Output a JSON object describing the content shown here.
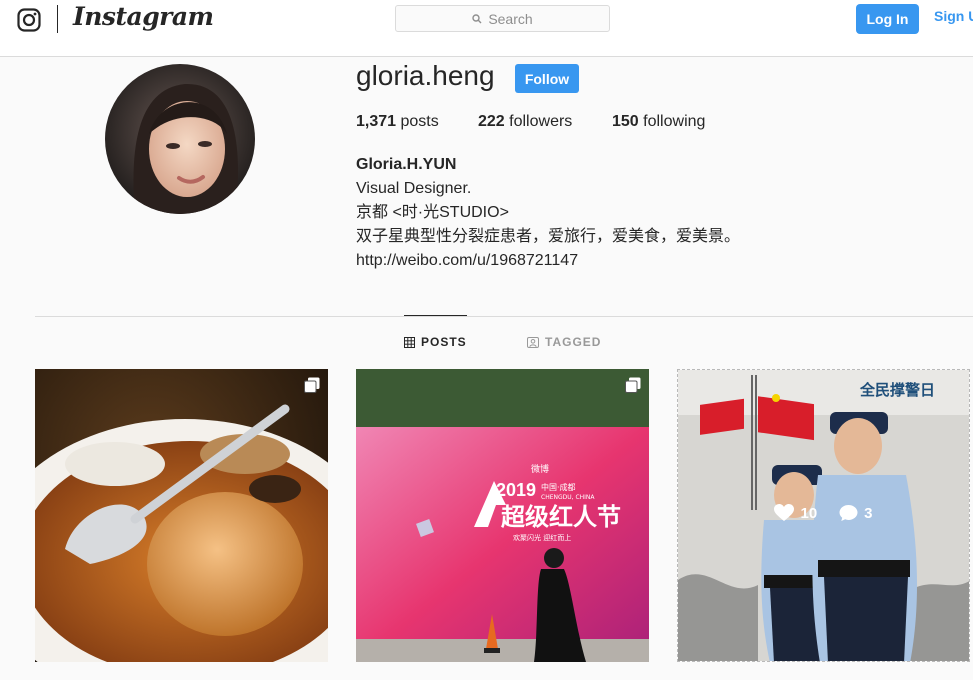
{
  "nav": {
    "brand": "Instagram",
    "search_placeholder": "Search",
    "login_label": "Log In",
    "signup_label": "Sign Up"
  },
  "profile": {
    "username": "gloria.heng",
    "follow_label": "Follow",
    "stats": [
      {
        "count": "1,371",
        "label": "posts"
      },
      {
        "count": "222",
        "label": "followers"
      },
      {
        "count": "150",
        "label": "following"
      }
    ],
    "full_name": "Gloria.H.YUN",
    "bio_lines": [
      "Visual Designer.",
      "京都 <时·光STUDIO>",
      "双子星典型性分裂症患者，爱旅行，爱美食，爱美景。"
    ],
    "link": "http://weibo.com/u/1968721147"
  },
  "tabs": {
    "posts_label": "POSTS",
    "tagged_label": "TAGGED"
  },
  "posts": [
    {
      "type": "multi",
      "description_icon": "carousel-icon"
    },
    {
      "type": "multi",
      "description_icon": "carousel-icon",
      "poster_text": {
        "event_year": "2019",
        "city": "中国·成都",
        "city_en": "CHENGDU, CHINA",
        "event_name": "超级红人节",
        "tagline": "欢聚闪光 迎红而上",
        "sponsor": "微博"
      }
    },
    {
      "type": "single",
      "likes": "10",
      "comments": "3",
      "poster_text": "全民撑警日"
    }
  ],
  "colors": {
    "accent": "#3897f0",
    "border": "#dbdbdb",
    "text": "#262626",
    "muted": "#999999"
  }
}
